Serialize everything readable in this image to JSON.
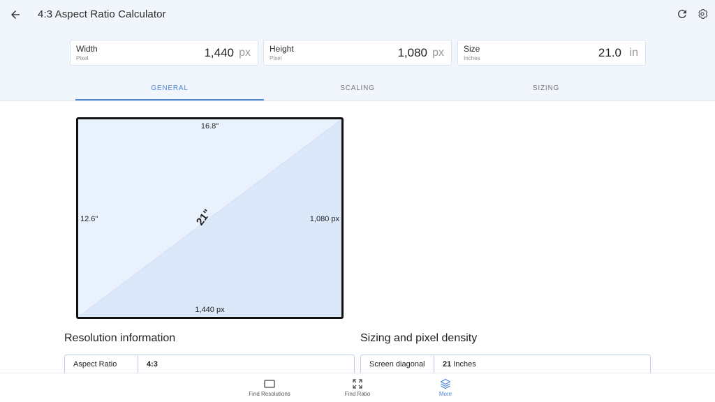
{
  "header": {
    "title": "4:3 Aspect Ratio Calculator",
    "icons": {
      "back": "back-arrow-icon",
      "refresh": "refresh-icon",
      "settings": "gear-icon"
    }
  },
  "fields": [
    {
      "label": "Width",
      "sublabel": "Pixel",
      "value": "1,440",
      "unit": "px"
    },
    {
      "label": "Height",
      "sublabel": "Pixel",
      "value": "1,080",
      "unit": "px"
    },
    {
      "label": "Size",
      "sublabel": "Inches",
      "value": "21.0",
      "unit": "in"
    }
  ],
  "tabs": [
    {
      "label": "GENERAL",
      "active": true
    },
    {
      "label": "SCALING",
      "active": false
    },
    {
      "label": "SIZING",
      "active": false
    }
  ],
  "diagram": {
    "top": "16.8\"",
    "bottom": "1,440 px",
    "left": "12.6\"",
    "right": "1,080 px",
    "diagonal": "21\""
  },
  "resolution": {
    "title": "Resolution information",
    "rows": [
      {
        "key": "Aspect Ratio",
        "value": "4:3"
      }
    ]
  },
  "sizing": {
    "title": "Sizing and pixel density",
    "rows": [
      {
        "key": "Screen diagonal",
        "value_bold": "21",
        "value_rest": " Inches"
      }
    ]
  },
  "bottom_nav": [
    {
      "label": "Find Resolutions",
      "icon": "monitor-icon",
      "active": false
    },
    {
      "label": "Find Ratio",
      "icon": "expand-icon",
      "active": false
    },
    {
      "label": "More",
      "icon": "layers-icon",
      "active": true
    }
  ],
  "colors": {
    "accent": "#4a88d8",
    "header_bg": "#f1f6fd"
  }
}
